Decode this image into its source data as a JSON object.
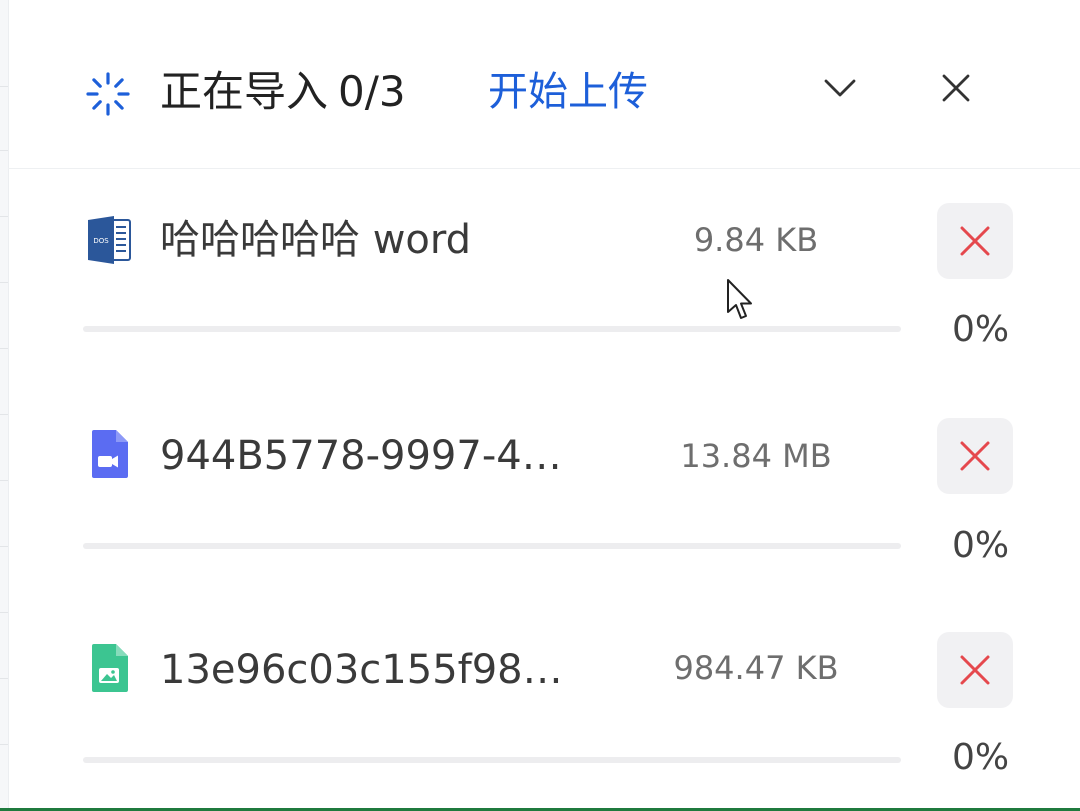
{
  "header": {
    "spinner_icon": "loading-spinner-icon",
    "status_label": "正在导入",
    "count": "0/3",
    "start_upload_label": "开始上传",
    "collapse_icon": "chevron-down-icon",
    "close_icon": "close-icon",
    "accent_color": "#1d5fd9"
  },
  "files": [
    {
      "name": "哈哈哈哈哈 word",
      "size": "9.84 KB",
      "progress_label": "0%",
      "progress": 0,
      "icon": "word-document-icon",
      "icon_color": "#2b579a",
      "remove_icon": "remove-x-icon"
    },
    {
      "name": "944B5778-9997-4…",
      "size": "13.84 MB",
      "progress_label": "0%",
      "progress": 0,
      "icon": "video-file-icon",
      "icon_color": "#5b6cf2",
      "remove_icon": "remove-x-icon"
    },
    {
      "name": "13e96c03c155f98…",
      "size": "984.47 KB",
      "progress_label": "0%",
      "progress": 0,
      "icon": "image-file-icon",
      "icon_color": "#3cc591",
      "remove_icon": "remove-x-icon"
    }
  ],
  "remove_icon_color": "#e5484d"
}
